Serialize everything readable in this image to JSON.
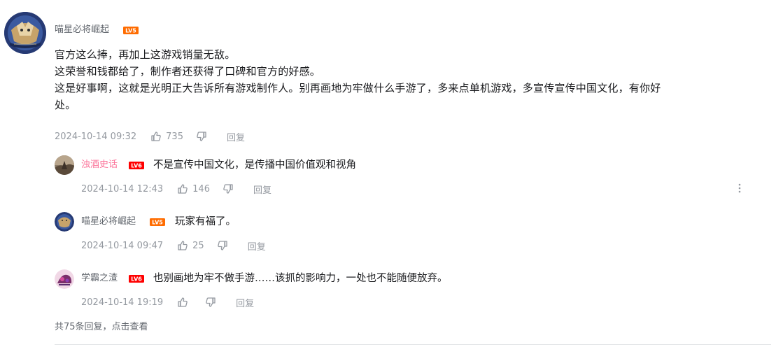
{
  "main_comment": {
    "username": "喵星必将崛起",
    "level": "LV5",
    "lines": [
      "官方这么捧，再加上这游戏销量无敌。",
      "这荣誉和钱都给了，制作者还获得了口碑和官方的好感。",
      "这是好事啊，这就是光明正大告诉所有游戏制作人。别再画地为牢做什么手游了，多来点单机游戏，多宣传宣传中国文化，有你好",
      "处。"
    ],
    "time": "2024-10-14 09:32",
    "likes": "735",
    "reply_label": "回复"
  },
  "replies": [
    {
      "username": "浊酒史话",
      "level": "LV6",
      "text": "不是宣传中国文化，是传播中国价值观和视角",
      "time": "2024-10-14 12:43",
      "likes": "146",
      "reply_label": "回复"
    },
    {
      "username": "喵星必将崛起",
      "level": "LV5",
      "text": "玩家有福了。",
      "time": "2024-10-14 09:47",
      "likes": "25",
      "reply_label": "回复"
    },
    {
      "username": "学霸之渣",
      "level": "LV6",
      "text": "也别画地为牢不做手游……该抓的影响力，一处也不能随便放弃。",
      "time": "2024-10-14 19:19",
      "likes": "",
      "reply_label": "回复"
    }
  ],
  "view_more": "共75条回复，点击查看",
  "colors": {
    "text": "#18191c",
    "meta": "#9499a0",
    "pink_name": "#fb7299",
    "lv5": "#ff6c00",
    "lv6": "#ff0000"
  },
  "icons": [
    "like-icon",
    "dislike-icon",
    "more-vertical-icon"
  ]
}
